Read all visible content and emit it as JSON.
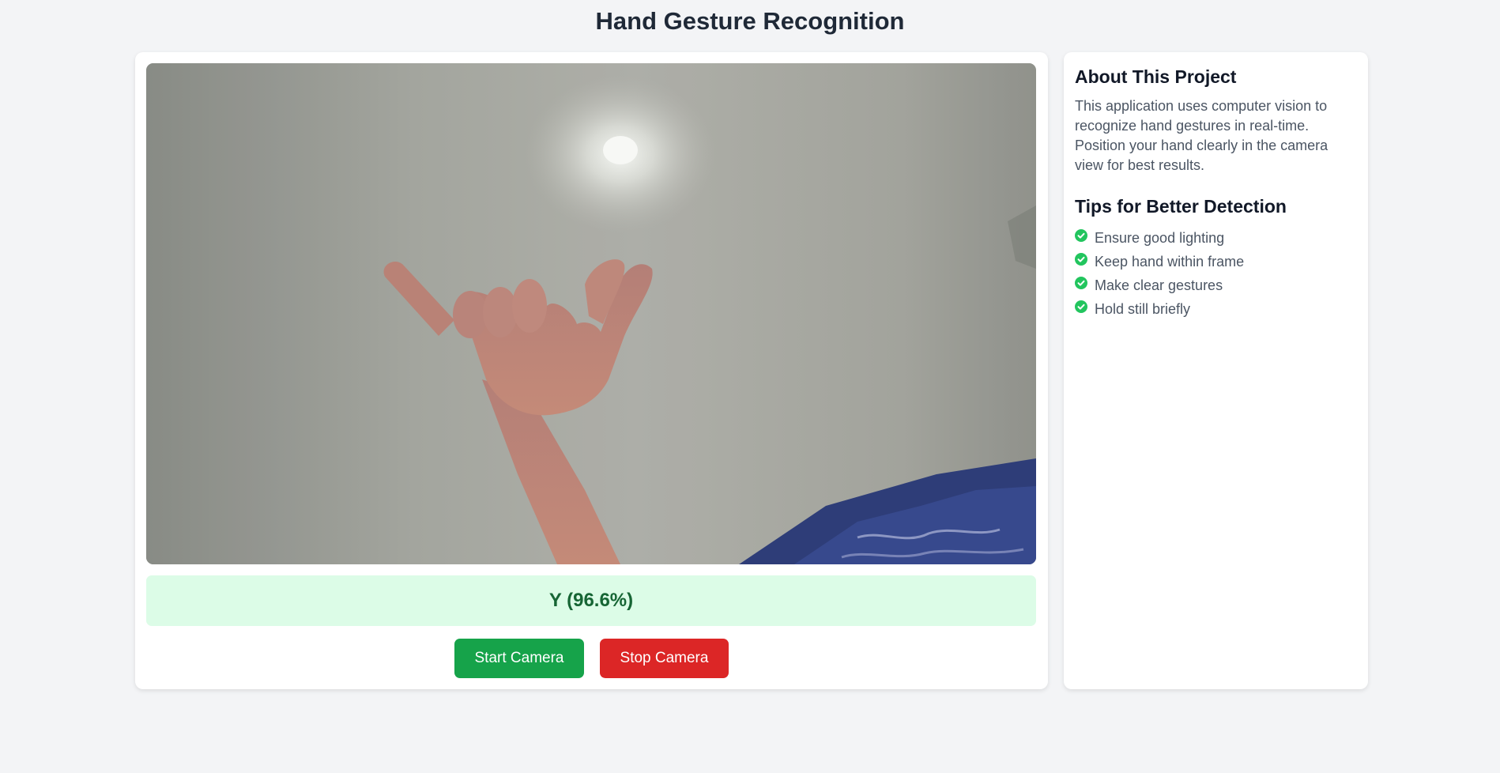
{
  "header": {
    "title": "Hand Gesture Recognition"
  },
  "camera": {
    "feed_icon": "webcam-feed-hand-shaka"
  },
  "prediction": {
    "text": "Y (96.6%)"
  },
  "controls": {
    "start_label": "Start Camera",
    "stop_label": "Stop Camera"
  },
  "about": {
    "title": "About This Project",
    "description": "This application uses computer vision to recognize hand gestures in real-time. Position your hand clearly in the camera view for best results."
  },
  "tips": {
    "title": "Tips for Better Detection",
    "icon": "check-circle-icon",
    "items": [
      "Ensure good lighting",
      "Keep hand within frame",
      "Make clear gestures",
      "Hold still briefly"
    ]
  },
  "colors": {
    "accent_green": "#16a34a",
    "danger_red": "#dc2626",
    "prediction_bg": "#dcfce7",
    "prediction_text": "#166534"
  }
}
